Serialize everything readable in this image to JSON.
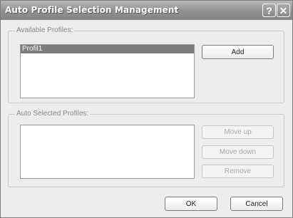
{
  "window": {
    "title": "Auto Profile Selection Management",
    "help_glyph": "?",
    "close_glyph": "✕"
  },
  "available": {
    "label": "Available Profiles:",
    "items": [
      "Profil1"
    ],
    "selected_index": 0,
    "add_label": "Add"
  },
  "auto_selected": {
    "label": "Auto Selected Profiles:",
    "items": [],
    "move_up_label": "Move up",
    "move_down_label": "Move down",
    "remove_label": "Remove"
  },
  "footer": {
    "ok_label": "OK",
    "cancel_label": "Cancel"
  }
}
